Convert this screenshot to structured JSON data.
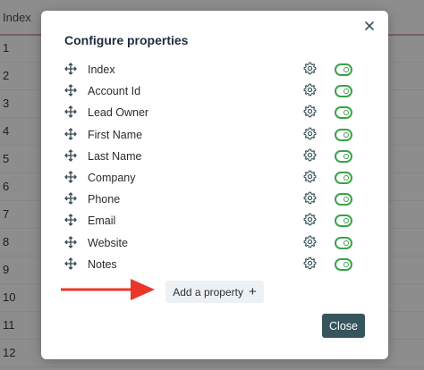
{
  "background_table": {
    "header": "Index",
    "rows": [
      "1",
      "2",
      "3",
      "4",
      "5",
      "6",
      "7",
      "8",
      "9",
      "10",
      "11",
      "12"
    ]
  },
  "modal": {
    "title": "Configure properties",
    "close_icon": "close-icon",
    "properties": [
      {
        "label": "Index",
        "enabled": true
      },
      {
        "label": "Account Id",
        "enabled": true
      },
      {
        "label": "Lead Owner",
        "enabled": true
      },
      {
        "label": "First Name",
        "enabled": true
      },
      {
        "label": "Last Name",
        "enabled": true
      },
      {
        "label": "Company",
        "enabled": true
      },
      {
        "label": "Phone",
        "enabled": true
      },
      {
        "label": "Email",
        "enabled": true
      },
      {
        "label": "Website",
        "enabled": true
      },
      {
        "label": "Notes",
        "enabled": true
      }
    ],
    "add_property_label": "Add a property",
    "add_property_icon": "+",
    "close_label": "Close"
  },
  "colors": {
    "accent_green": "#3aa34a",
    "close_button": "#37555c",
    "arrow_red": "#e8372a"
  }
}
